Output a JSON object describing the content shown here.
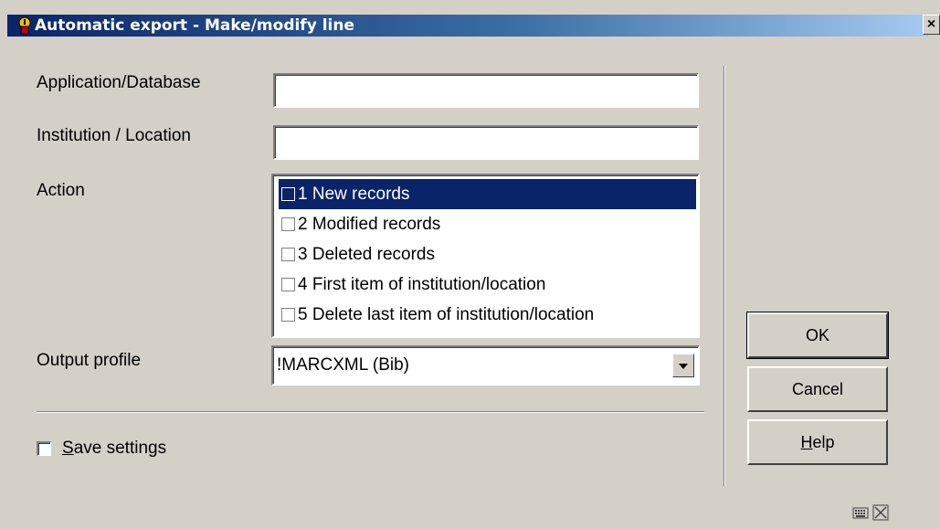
{
  "window": {
    "title": "Automatic export - Make/modify line",
    "close_label": "×"
  },
  "form": {
    "application_label": "Application/Database",
    "application_value": "",
    "institution_label": "Institution / Location",
    "institution_value": "",
    "action_label": "Action",
    "actions": [
      {
        "label": "1 New records",
        "selected": true,
        "checked": false
      },
      {
        "label": "2 Modified records",
        "selected": false,
        "checked": false
      },
      {
        "label": "3 Deleted records",
        "selected": false,
        "checked": false
      },
      {
        "label": "4 First item of institution/location",
        "selected": false,
        "checked": false
      },
      {
        "label": "5 Delete last item of institution/location",
        "selected": false,
        "checked": false
      }
    ],
    "output_profile_label": "Output profile",
    "output_profile_value": "!MARCXML (Bib)",
    "save_settings_prefix": "S",
    "save_settings_rest": "ave settings",
    "save_settings_checked": false
  },
  "buttons": {
    "ok": "OK",
    "cancel": "Cancel",
    "help_prefix": "H",
    "help_rest": "elp"
  },
  "status_icons": [
    "keyboard-icon",
    "resize-icon"
  ]
}
